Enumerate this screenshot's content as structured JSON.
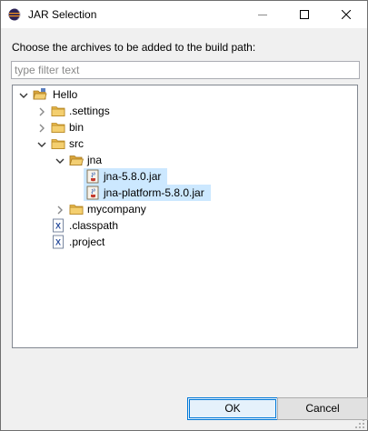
{
  "window": {
    "title": "JAR Selection",
    "icon": "eclipse-icon",
    "controls": {
      "minimize": "minimize-icon",
      "maximize": "maximize-icon",
      "close": "close-icon"
    }
  },
  "prompt": "Choose the archives to be added to the build path:",
  "filter": {
    "placeholder": "type filter text",
    "value": ""
  },
  "tree": {
    "items": [
      {
        "label": "Hello",
        "icon": "project-folder-icon",
        "expanded": true,
        "selected": false
      },
      {
        "label": ".settings",
        "icon": "folder-icon",
        "expanded": false,
        "selected": false
      },
      {
        "label": "bin",
        "icon": "folder-icon",
        "expanded": false,
        "selected": false
      },
      {
        "label": "src",
        "icon": "folder-icon",
        "expanded": true,
        "selected": false
      },
      {
        "label": "jna",
        "icon": "folder-open-icon",
        "expanded": true,
        "selected": false
      },
      {
        "label": "jna-5.8.0.jar",
        "icon": "jar-icon",
        "selected": true
      },
      {
        "label": "jna-platform-5.8.0.jar",
        "icon": "jar-icon",
        "selected": true
      },
      {
        "label": "mycompany",
        "icon": "folder-icon",
        "expanded": false,
        "selected": false
      },
      {
        "label": ".classpath",
        "icon": "xml-file-icon",
        "selected": false
      },
      {
        "label": ".project",
        "icon": "xml-file-icon",
        "selected": false
      }
    ]
  },
  "buttons": {
    "ok": "OK",
    "cancel": "Cancel"
  },
  "colors": {
    "selection": "#cce8ff",
    "folder": "#e8b84a",
    "accent": "#0078d7"
  }
}
